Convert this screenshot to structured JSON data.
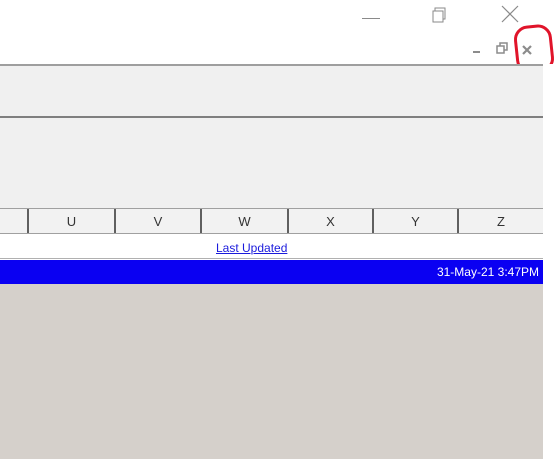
{
  "window": {
    "minimize_icon": "minimize-icon",
    "restore_icon": "restore-icon",
    "close_icon": "close-icon"
  },
  "child_window": {
    "minimize_label": "_",
    "restore_icon": "restore-icon",
    "close_label": "×",
    "highlight_color": "#e0142a"
  },
  "grid": {
    "columns": [
      "U",
      "V",
      "W",
      "X",
      "Y",
      "Z"
    ],
    "last_updated_label": "Last Updated",
    "selected_row": {
      "timestamp": "31-May-21 3:47PM",
      "color": "#0a00f2"
    },
    "empty_area_color": "#d5d0cb"
  }
}
